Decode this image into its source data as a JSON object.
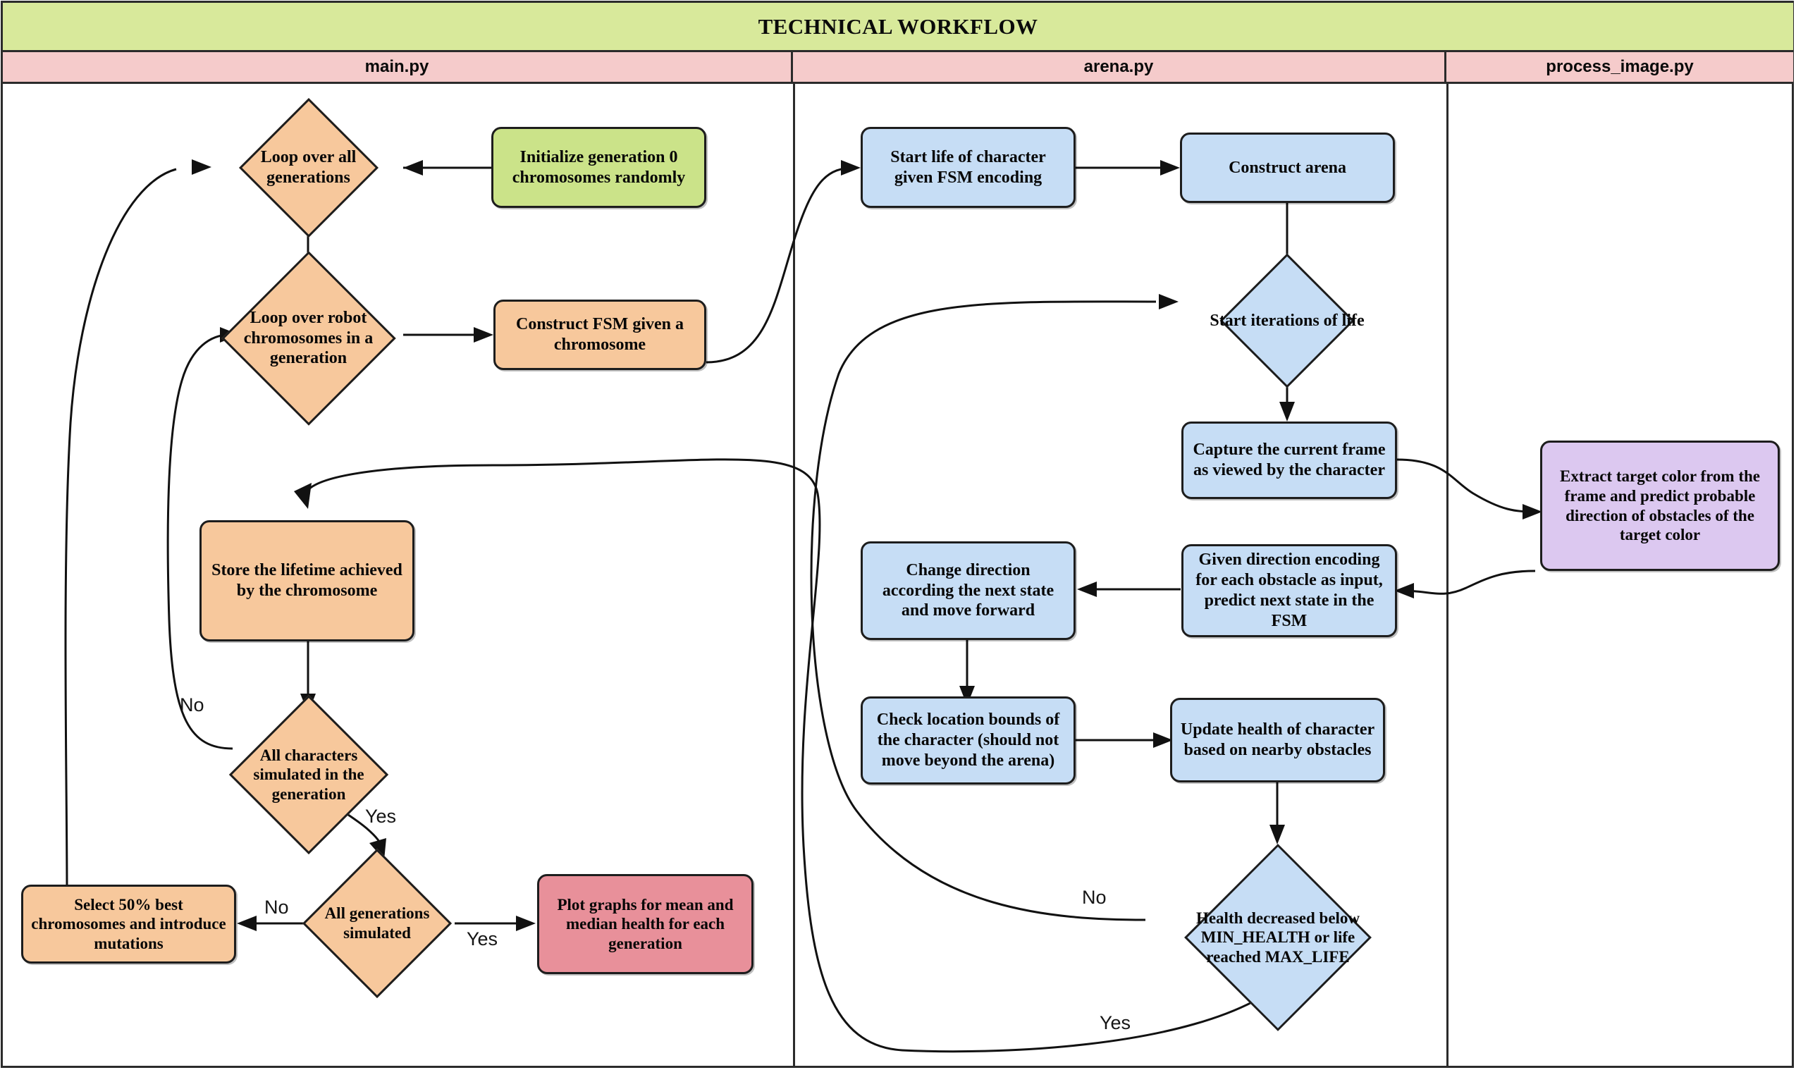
{
  "title": "TECHNICAL WORKFLOW",
  "lanes": [
    {
      "id": "main",
      "label": "main.py"
    },
    {
      "id": "arena",
      "label": "arena.py"
    },
    {
      "id": "process",
      "label": "process_image.py"
    }
  ],
  "colors": {
    "title_band": "#d8e99b",
    "lane_header": "#f5cbcb",
    "main_node": "#f7c89c",
    "init_node": "#cbe389",
    "plot_node": "#e8909a",
    "arena_node": "#c6ddf5",
    "process_node": "#dcc8f0",
    "stroke": "#1d1d1d"
  },
  "nodes": {
    "init_chromosomes": {
      "label": "Initialize generation 0 chromosomes randomly",
      "shape": "process",
      "lane": "main",
      "color": "#cbe389"
    },
    "loop_generations": {
      "label": "Loop over all generations",
      "shape": "decision",
      "lane": "main",
      "color": "#f7c89c"
    },
    "loop_chromosomes": {
      "label": "Loop over robot chromosomes in a generation",
      "shape": "decision",
      "lane": "main",
      "color": "#f7c89c"
    },
    "construct_fsm": {
      "label": "Construct FSM given a chromosome",
      "shape": "process",
      "lane": "main",
      "color": "#f7c89c"
    },
    "store_lifetime": {
      "label": "Store the lifetime achieved by the chromosome",
      "shape": "process",
      "lane": "main",
      "color": "#f7c89c"
    },
    "all_characters": {
      "label": "All characters simulated in the generation",
      "shape": "decision",
      "lane": "main",
      "color": "#f7c89c"
    },
    "all_generations": {
      "label": "All generations simulated",
      "shape": "decision",
      "lane": "main",
      "color": "#f7c89c"
    },
    "select_best": {
      "label": "Select 50% best chromosomes and introduce mutations",
      "shape": "process",
      "lane": "main",
      "color": "#f7c89c"
    },
    "plot_graphs": {
      "label": "Plot graphs for mean and median health for each generation",
      "shape": "process",
      "lane": "main",
      "color": "#e8909a"
    },
    "start_life": {
      "label": "Start life of character given FSM encoding",
      "shape": "process",
      "lane": "arena",
      "color": "#c6ddf5"
    },
    "construct_arena": {
      "label": "Construct arena",
      "shape": "process",
      "lane": "arena",
      "color": "#c6ddf5"
    },
    "start_iterations": {
      "label": "Start iterations of life",
      "shape": "decision",
      "lane": "arena",
      "color": "#c6ddf5"
    },
    "capture_frame": {
      "label": "Capture the current frame as viewed by the character",
      "shape": "process",
      "lane": "arena",
      "color": "#c6ddf5"
    },
    "predict_state": {
      "label": "Given direction encoding for each obstacle as input, predict next state in the FSM",
      "shape": "process",
      "lane": "arena",
      "color": "#c6ddf5"
    },
    "change_direction": {
      "label": "Change direction according the next state and move forward",
      "shape": "process",
      "lane": "arena",
      "color": "#c6ddf5"
    },
    "check_bounds": {
      "label": "Check location bounds of the character (should not move beyond the arena)",
      "shape": "process",
      "lane": "arena",
      "color": "#c6ddf5"
    },
    "update_health": {
      "label": "Update health of character based on nearby obstacles",
      "shape": "process",
      "lane": "arena",
      "color": "#c6ddf5"
    },
    "health_check": {
      "label": "Health decreased below MIN_HEALTH or life reached MAX_LIFE",
      "shape": "decision",
      "lane": "arena",
      "color": "#c6ddf5"
    },
    "extract_color": {
      "label": "Extract target color from the frame and predict probable direction of obstacles of the target color",
      "shape": "process",
      "lane": "process",
      "color": "#dcc8f0"
    }
  },
  "edge_labels": {
    "all_characters_no": "No",
    "all_characters_yes": "Yes",
    "all_generations_no": "No",
    "all_generations_yes": "Yes",
    "health_no": "No",
    "health_yes": "Yes"
  }
}
